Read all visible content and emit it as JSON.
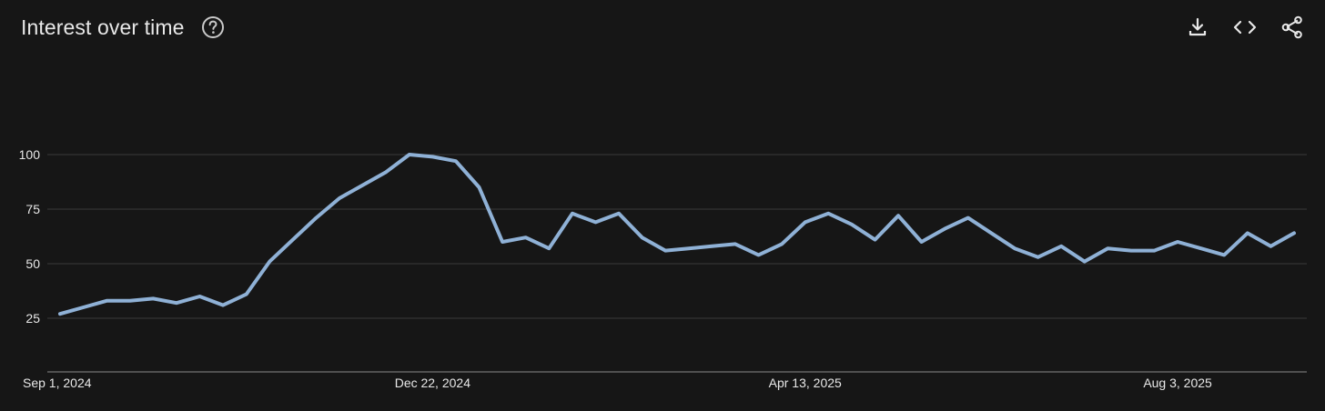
{
  "header": {
    "title": "Interest over time",
    "help_icon": "help-circle-icon",
    "actions": [
      {
        "name": "download-button",
        "icon": "download-icon"
      },
      {
        "name": "embed-button",
        "icon": "code-icon"
      },
      {
        "name": "share-button",
        "icon": "share-icon"
      }
    ]
  },
  "colors": {
    "background": "#161616",
    "line": "#8fb1d6",
    "grid": "#3a3a3a",
    "axis": "#8a8a8a",
    "text": "#e8e8e8"
  },
  "chart_data": {
    "type": "line",
    "title": "Interest over time",
    "xlabel": "",
    "ylabel": "",
    "ylim": [
      0,
      100
    ],
    "yticks": [
      25,
      50,
      75,
      100
    ],
    "x_ticks": [
      "Sep 1, 2024",
      "Dec 22, 2024",
      "Apr 13, 2025",
      "Aug 3, 2025"
    ],
    "x_tick_index": [
      0,
      16,
      32,
      48
    ],
    "grid": true,
    "series": [
      {
        "values": [
          27,
          30,
          33,
          33,
          34,
          32,
          35,
          31,
          36,
          51,
          61,
          71,
          80,
          86,
          92,
          100,
          99,
          97,
          85,
          60,
          62,
          57,
          73,
          69,
          73,
          62,
          56,
          57,
          58,
          59,
          54,
          59,
          69,
          73,
          68,
          61,
          72,
          60,
          66,
          71,
          64,
          57,
          53,
          58,
          51,
          57,
          56,
          56,
          60,
          57,
          54,
          64,
          58,
          64
        ]
      }
    ]
  }
}
